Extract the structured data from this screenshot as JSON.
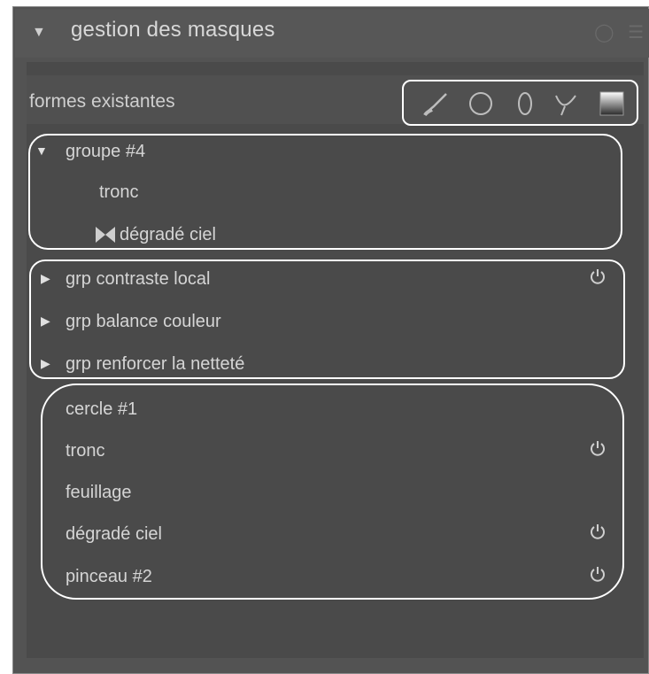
{
  "module": {
    "title": "gestion des masques",
    "collapse_icon": "triangle-down",
    "header_icons": [
      "power-icon",
      "menu-icon"
    ]
  },
  "shapes_section": {
    "label": "formes existantes",
    "tools": [
      "brush-icon",
      "circle-icon",
      "ellipse-icon",
      "path-icon",
      "gradient-icon"
    ]
  },
  "groups": {
    "expanded_group": {
      "name": "groupe #4",
      "children": [
        {
          "label": "tronc",
          "icon": ""
        },
        {
          "label": "dégradé ciel",
          "icon": "gradient-shape-icon"
        }
      ]
    },
    "collapsed_groups": [
      {
        "label": "grp contraste local",
        "power": true
      },
      {
        "label": "grp balance couleur",
        "power": false
      },
      {
        "label": "grp renforcer la netteté",
        "power": false
      }
    ]
  },
  "shapes": [
    {
      "label": "cercle #1",
      "power": false
    },
    {
      "label": "tronc",
      "power": true
    },
    {
      "label": "feuillage",
      "power": false
    },
    {
      "label": "dégradé ciel",
      "power": true
    },
    {
      "label": "pinceau #2",
      "power": true
    }
  ]
}
